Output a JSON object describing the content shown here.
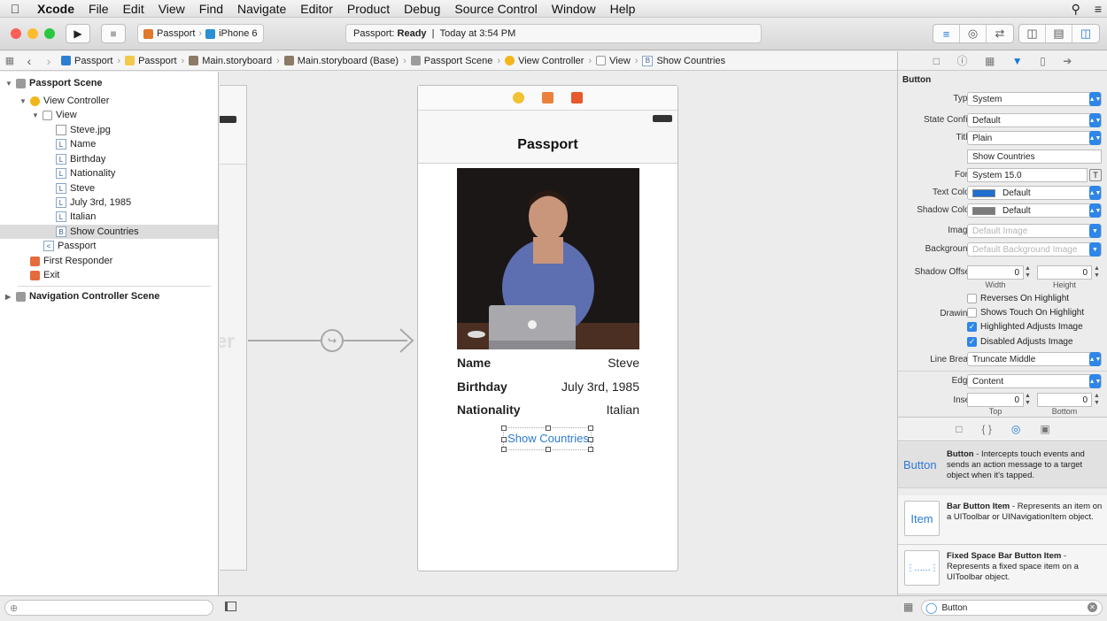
{
  "menubar": {
    "app": "Xcode",
    "items": [
      "File",
      "Edit",
      "View",
      "Find",
      "Navigate",
      "Editor",
      "Product",
      "Debug",
      "Source Control",
      "Window",
      "Help"
    ]
  },
  "toolbar": {
    "scheme": "Passport",
    "device": "iPhone 6",
    "status_project": "Passport:",
    "status_state": "Ready",
    "status_time": "Today at 3:54 PM"
  },
  "jumpbar": {
    "crumbs": [
      "Passport",
      "Passport",
      "Main.storyboard",
      "Main.storyboard (Base)",
      "Passport Scene",
      "View Controller",
      "View",
      "Show Countries"
    ]
  },
  "outline": {
    "scene": "Passport Scene",
    "view_controller": "View Controller",
    "view": "View",
    "children": [
      {
        "badge": "",
        "label": "Steve.jpg"
      },
      {
        "badge": "L",
        "label": "Name"
      },
      {
        "badge": "L",
        "label": "Birthday"
      },
      {
        "badge": "L",
        "label": "Nationality"
      },
      {
        "badge": "L",
        "label": "Steve"
      },
      {
        "badge": "L",
        "label": "July 3rd, 1985"
      },
      {
        "badge": "L",
        "label": "Italian"
      },
      {
        "badge": "B",
        "label": "Show Countries"
      }
    ],
    "back_item": "Passport",
    "first_responder": "First Responder",
    "exit": "Exit",
    "nav_scene": "Navigation Controller Scene"
  },
  "scene": {
    "nav_title": "Passport",
    "rows": [
      {
        "key": "Name",
        "value": "Steve"
      },
      {
        "key": "Birthday",
        "value": "July 3rd, 1985"
      },
      {
        "key": "Nationality",
        "value": "Italian"
      }
    ],
    "button": "Show Countries",
    "ghost_text": "er"
  },
  "inspector": {
    "section": "Button",
    "type_label": "Type",
    "type": "System",
    "state_label": "State Config",
    "state": "Default",
    "title_label": "Title",
    "title_type": "Plain",
    "title_text": "Show Countries",
    "font_label": "Font",
    "font": "System 15.0",
    "text_color_label": "Text Color",
    "text_color": "Default",
    "text_color_swatch": "#1e6fd0",
    "shadow_color_label": "Shadow Color",
    "shadow_color": "Default",
    "shadow_color_swatch": "#7a7a7a",
    "image_label": "Image",
    "image_placeholder": "Default Image",
    "background_label": "Background",
    "background_placeholder": "Default Background Image",
    "shadow_offset_label": "Shadow Offset",
    "shadow_w": "0",
    "shadow_h": "0",
    "width_label": "Width",
    "height_label": "Height",
    "drawing_label": "Drawing",
    "checks": [
      {
        "label": "Reverses On Highlight",
        "on": false
      },
      {
        "label": "Shows Touch On Highlight",
        "on": false
      },
      {
        "label": "Highlighted Adjusts Image",
        "on": true
      },
      {
        "label": "Disabled Adjusts Image",
        "on": true
      }
    ],
    "linebreak_label": "Line Break",
    "linebreak": "Truncate Middle",
    "edge_label": "Edge",
    "edge": "Content",
    "inset_label": "Inset",
    "inset_top": "0",
    "inset_bottom": "0",
    "top_label": "Top",
    "bottom_label": "Bottom"
  },
  "library": [
    {
      "thumb": "Button",
      "name": "Button",
      "desc": " - Intercepts touch events and sends an action message to a target object when it's tapped."
    },
    {
      "thumb": "Item",
      "name": "Bar Button Item",
      "desc": " - Represents an item on a UIToolbar or UINavigationItem object."
    },
    {
      "thumb": "",
      "name": "Fixed Space Bar Button Item",
      "desc": " - Represents a fixed space item on a UIToolbar object."
    }
  ],
  "filter_value": "Button",
  "colors": {
    "accent": "#2d86e8",
    "close": "#fc5f57",
    "min": "#fdbc2e",
    "max": "#28c840"
  }
}
